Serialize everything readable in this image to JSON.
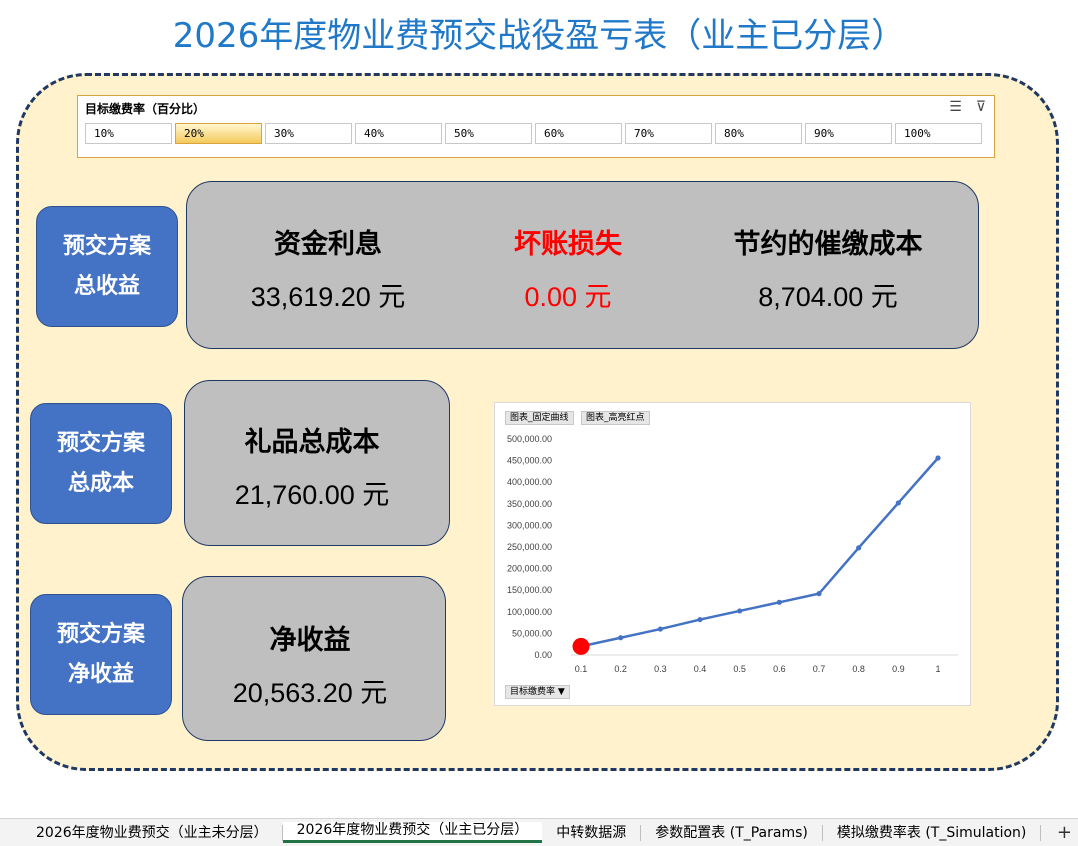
{
  "title": "2026年度物业费预交战役盈亏表（业主已分层）",
  "slicer": {
    "header": "目标缴费率（百分比）",
    "items": [
      "10%",
      "20%",
      "30%",
      "40%",
      "50%",
      "60%",
      "70%",
      "80%",
      "90%",
      "100%"
    ],
    "selected": "20%",
    "icons": [
      "multi-select-icon",
      "clear-filter-icon"
    ]
  },
  "income": {
    "label_line1": "预交方案",
    "label_line2": "总收益",
    "items": [
      {
        "label": "资金利息",
        "value": "33,619.20 元"
      },
      {
        "label": "坏账损失",
        "value": "0.00 元",
        "color": "#ff0000"
      },
      {
        "label": "节约的催缴成本",
        "value": "8,704.00 元"
      }
    ]
  },
  "cost": {
    "label_line1": "预交方案",
    "label_line2": "总成本",
    "label": "礼品总成本",
    "value": "21,760.00 元"
  },
  "net": {
    "label_line1": "预交方案",
    "label_line2": "净收益",
    "label": "净收益",
    "value": "20,563.20 元"
  },
  "chart_field_buttons": [
    "图表_固定曲线",
    "图表_高亮红点"
  ],
  "chart_axis_button": "目标缴费率",
  "chart_data": {
    "type": "line",
    "title": "",
    "xlabel": "",
    "ylabel": "",
    "x": [
      "0.1",
      "0.2",
      "0.3",
      "0.4",
      "0.5",
      "0.6",
      "0.7",
      "0.8",
      "0.9",
      "1"
    ],
    "y_ticks": [
      "0.00",
      "50,000.00",
      "100,000.00",
      "150,000.00",
      "200,000.00",
      "250,000.00",
      "300,000.00",
      "350,000.00",
      "400,000.00",
      "450,000.00",
      "500,000.00"
    ],
    "ylim": [
      0,
      500000
    ],
    "series": [
      {
        "values": [
          20000,
          40000,
          60000,
          82000,
          102000,
          122000,
          142000,
          248000,
          352000,
          456000
        ],
        "color": "#4472c4"
      }
    ],
    "highlight": {
      "x": "0.1",
      "y": 20000,
      "color": "#ff0000"
    },
    "grid": false,
    "legend": "none"
  },
  "tabs": [
    {
      "label": "2026年度物业费预交（业主未分层）",
      "active": false
    },
    {
      "label": "2026年度物业费预交（业主已分层）",
      "active": true
    },
    {
      "label": "中转数据源",
      "active": false
    },
    {
      "label": "参数配置表 (T_Params)",
      "active": false
    },
    {
      "label": "模拟缴费率表 (T_Simulation)",
      "active": false
    }
  ],
  "tab_add": "+"
}
